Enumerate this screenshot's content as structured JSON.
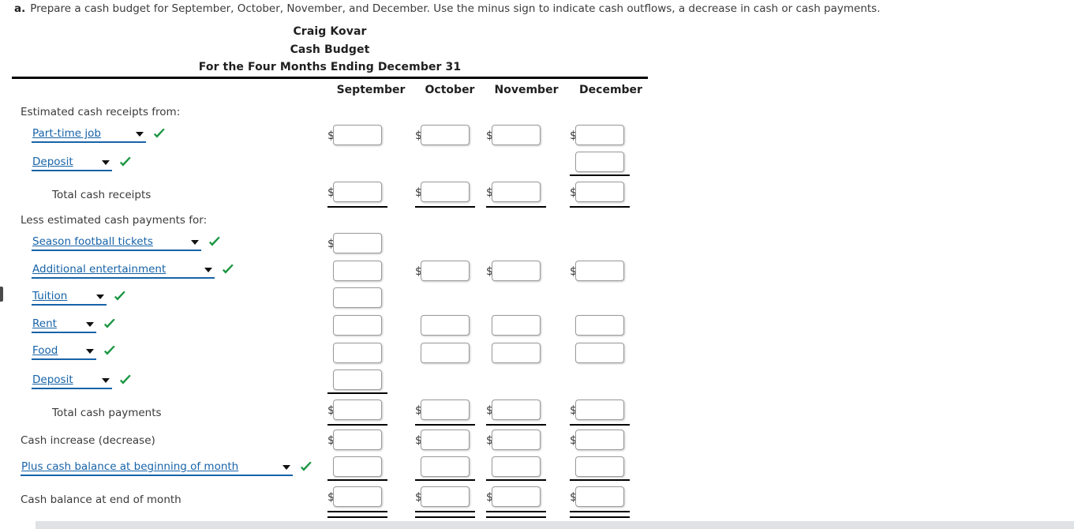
{
  "instruction": {
    "marker": "a.",
    "text": "Prepare a cash budget for September, October, November, and December. Use the minus sign to indicate cash outflows, a decrease in cash or cash payments."
  },
  "statement": {
    "company": "Craig Kovar",
    "title": "Cash Budget",
    "period": "For the Four Months Ending December 31"
  },
  "columns": [
    {
      "label": "September"
    },
    {
      "label": "October"
    },
    {
      "label": "November"
    },
    {
      "label": "December"
    }
  ],
  "sections": {
    "receipts_header": "Estimated cash receipts from:",
    "receipts_total": "Total cash receipts",
    "payments_header": "Less estimated cash payments for:",
    "payments_total": "Total cash payments",
    "cash_increase": "Cash increase (decrease)",
    "cash_end": "Cash balance at end of month"
  },
  "dropdowns": {
    "receipt_1": "Part-time job",
    "receipt_2": "Deposit",
    "payment_1": "Season football tickets",
    "payment_2": "Additional entertainment",
    "payment_3": "Tuition",
    "payment_4": "Rent",
    "payment_5": "Food",
    "payment_6": "Deposit",
    "plus_balance": "Plus cash balance at beginning of month"
  },
  "dropdown_options": {
    "receipts": [
      "Part-time job",
      "Deposit",
      "Season football tickets",
      "Additional entertainment",
      "Tuition",
      "Rent",
      "Food"
    ],
    "balance": [
      "Plus cash balance at beginning of month"
    ]
  },
  "field_values": {
    "empty": ""
  },
  "field_placeholder": "",
  "symbols": {
    "dollar": "$",
    "check": "check-mark",
    "dropdown_arrow": "chevron-down"
  },
  "colors": {
    "link": "#1763a8",
    "check": "#1a9641",
    "rule": "#000000",
    "text": "#3a3a3a",
    "bottom_bar": "#dfe3e6"
  }
}
